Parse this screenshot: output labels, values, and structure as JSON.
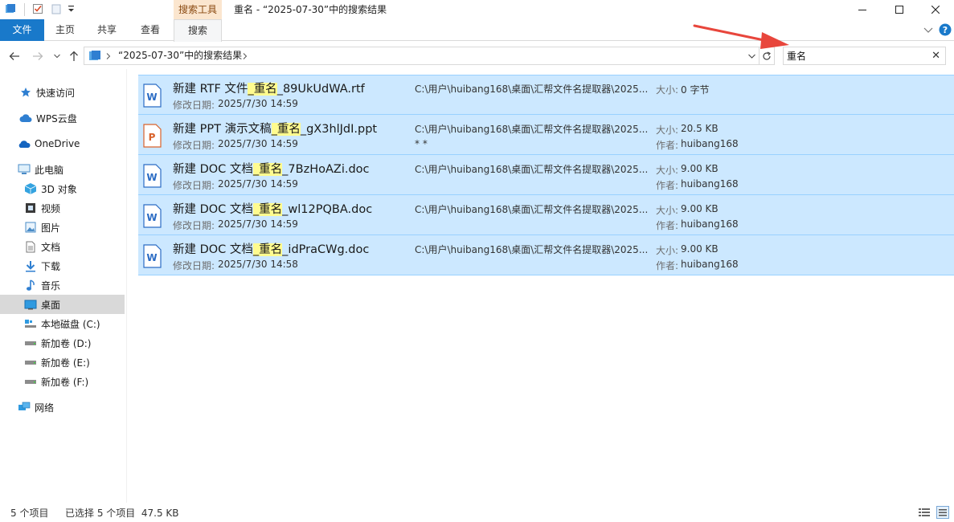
{
  "titlebar": {
    "search_tools_tab": "搜索工具",
    "title": "重名 - “2025-07-30”中的搜索结果"
  },
  "ribbon": {
    "tabs": [
      {
        "label": "文件"
      },
      {
        "label": "主页"
      },
      {
        "label": "共享"
      },
      {
        "label": "查看"
      },
      {
        "label": "搜索"
      }
    ],
    "active_tab": "搜索"
  },
  "address": {
    "path": "“2025-07-30”中的搜索结果"
  },
  "search": {
    "value": "重名"
  },
  "nav": {
    "items": [
      {
        "label": "快速访问",
        "icon": "star-icon"
      },
      {
        "label": "WPS云盘",
        "icon": "cloud-icon"
      },
      {
        "label": "OneDrive",
        "icon": "onedrive-icon"
      },
      {
        "label": "此电脑",
        "icon": "computer-icon"
      },
      {
        "label": "3D 对象",
        "icon": "cube-icon"
      },
      {
        "label": "视频",
        "icon": "video-icon"
      },
      {
        "label": "图片",
        "icon": "picture-icon"
      },
      {
        "label": "文档",
        "icon": "document-icon"
      },
      {
        "label": "下载",
        "icon": "download-icon"
      },
      {
        "label": "音乐",
        "icon": "music-icon"
      },
      {
        "label": "桌面",
        "icon": "desktop-icon",
        "selected": true
      },
      {
        "label": "本地磁盘 (C:)",
        "icon": "drive-c-icon"
      },
      {
        "label": "新加卷 (D:)",
        "icon": "drive-icon"
      },
      {
        "label": "新加卷 (E:)",
        "icon": "drive-icon"
      },
      {
        "label": "新加卷 (F:)",
        "icon": "drive-icon"
      },
      {
        "label": "网络",
        "icon": "network-icon"
      }
    ]
  },
  "results": {
    "date_label": "修改日期:",
    "size_label": "大小:",
    "author_label": "作者:",
    "files": [
      {
        "prefix": "新建 RTF 文件",
        "sep": "_",
        "match": "重名",
        "suffix": "_89UkUdWA.rtf",
        "date": "2025/7/30 14:59",
        "path": "C:\\用户\\huibang168\\桌面\\汇帮文件名提取器\\2025...",
        "extra": "",
        "size": "0 字节",
        "author": "",
        "type": "word"
      },
      {
        "prefix": "新建 PPT 演示文稿",
        "sep": "_",
        "match": "重名",
        "suffix": "_gX3hlJdI.ppt",
        "date": "2025/7/30 14:59",
        "path": "C:\\用户\\huibang168\\桌面\\汇帮文件名提取器\\2025...",
        "extra": "* *",
        "size": "20.5 KB",
        "author": "huibang168",
        "type": "ppt"
      },
      {
        "prefix": "新建 DOC 文档",
        "sep": "_",
        "match": "重名",
        "suffix": "_7BzHoAZi.doc",
        "date": "2025/7/30 14:59",
        "path": "C:\\用户\\huibang168\\桌面\\汇帮文件名提取器\\2025...",
        "extra": "",
        "size": "9.00 KB",
        "author": "huibang168",
        "type": "word"
      },
      {
        "prefix": "新建 DOC 文档",
        "sep": "_",
        "match": "重名",
        "suffix": "_wl12PQBA.doc",
        "date": "2025/7/30 14:59",
        "path": "C:\\用户\\huibang168\\桌面\\汇帮文件名提取器\\2025...",
        "extra": "",
        "size": "9.00 KB",
        "author": "huibang168",
        "type": "word"
      },
      {
        "prefix": "新建 DOC 文档",
        "sep": "_",
        "match": "重名",
        "suffix": "_idPraCWg.doc",
        "date": "2025/7/30 14:58",
        "path": "C:\\用户\\huibang168\\桌面\\汇帮文件名提取器\\2025...",
        "extra": "",
        "size": "9.00 KB",
        "author": "huibang168",
        "type": "word"
      }
    ]
  },
  "status": {
    "count": "5 个项目",
    "selected": "已选择 5 个项目  47.5 KB"
  },
  "colors": {
    "accent": "#1979ca",
    "selection": "#cce8ff",
    "highlight": "#fffb8f",
    "arrow": "#e8463c"
  }
}
